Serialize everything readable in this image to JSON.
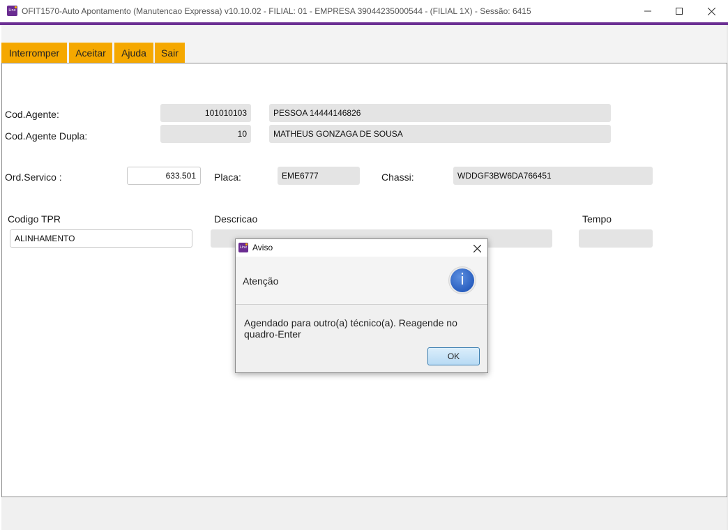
{
  "window": {
    "title": "OFIT1570-Auto Apontamento (Manutencao Expressa) v10.10.02   - FILIAL: 01 - EMPRESA 39044235000544 - (FILIAL 1X) - Sessão: 6415",
    "logo_text": "Linx"
  },
  "toolbar": {
    "interromper": "Interromper",
    "aceitar": "Aceitar",
    "ajuda": "Ajuda",
    "sair": "Sair"
  },
  "form": {
    "cod_agente_label": "Cod.Agente:",
    "cod_agente_value": "101010103",
    "cod_agente_name": "PESSOA 14444146826",
    "cod_agente_dupla_label": "Cod.Agente Dupla:",
    "cod_agente_dupla_value": "10",
    "cod_agente_dupla_name": "MATHEUS GONZAGA DE SOUSA",
    "ord_servico_label": "Ord.Servico :",
    "ord_servico_value": "633.501",
    "placa_label": "Placa:",
    "placa_value": "EME6777",
    "chassi_label": "Chassi:",
    "chassi_value": "WDDGF3BW6DA766451",
    "codigo_tpr_label": "Codigo TPR",
    "codigo_tpr_value": "ALINHAMENTO",
    "descricao_label": "Descricao",
    "descricao_value": "",
    "tempo_label": "Tempo",
    "tempo_value": ""
  },
  "dialog": {
    "title": "Aviso",
    "logo_text": "Linx",
    "heading": "Atenção",
    "info_glyph": "i",
    "message": "Agendado para outro(a) técnico(a). Reagende no quadro-Enter",
    "ok_label": "OK"
  },
  "colors": {
    "accent_purple": "#6b2f93",
    "toolbar_orange": "#f5a800",
    "readonly_gray": "#e4e4e4",
    "info_blue": "#2a5fc0"
  }
}
